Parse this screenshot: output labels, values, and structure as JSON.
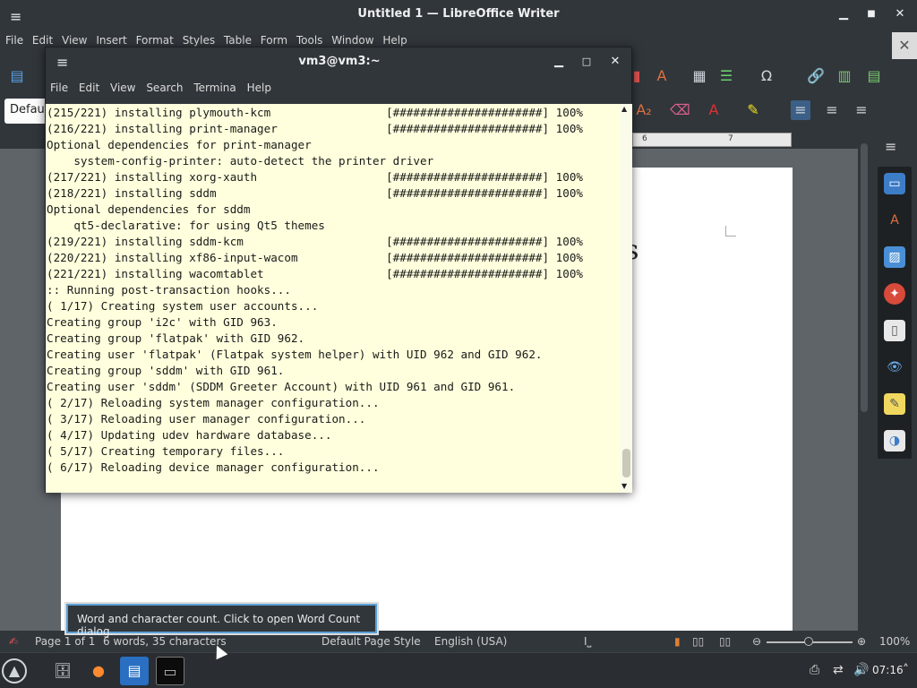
{
  "writer": {
    "title": "Untitled 1 — LibreOffice Writer",
    "menu": [
      "File",
      "Edit",
      "View",
      "Insert",
      "Format",
      "Styles",
      "Table",
      "Form",
      "Tools",
      "Window",
      "Help"
    ],
    "paragraph_style": "Default",
    "ruler_marks": [
      "6",
      "7"
    ],
    "page_visible_text": "s",
    "status": {
      "page": "Page 1 of 1",
      "words": "6 words, 35 characters",
      "page_style": "Default Page Style",
      "language": "English (USA)",
      "zoom": "100%"
    },
    "tooltip": "Word and character count. Click to open Word Count dialog."
  },
  "terminal": {
    "title": "vm3@vm3:~",
    "menu": [
      "File",
      "Edit",
      "View",
      "Search",
      "Termina",
      "Help"
    ],
    "lines": [
      "(215/221) installing plymouth-kcm                 [######################] 100%",
      "(216/221) installing print-manager                [######################] 100%",
      "Optional dependencies for print-manager",
      "    system-config-printer: auto-detect the printer driver",
      "(217/221) installing xorg-xauth                   [######################] 100%",
      "(218/221) installing sddm                         [######################] 100%",
      "Optional dependencies for sddm",
      "    qt5-declarative: for using Qt5 themes",
      "(219/221) installing sddm-kcm                     [######################] 100%",
      "(220/221) installing xf86-input-wacom             [######################] 100%",
      "(221/221) installing wacomtablet                  [######################] 100%",
      ":: Running post-transaction hooks...",
      "( 1/17) Creating system user accounts...",
      "Creating group 'i2c' with GID 963.",
      "Creating group 'flatpak' with GID 962.",
      "Creating user 'flatpak' (Flatpak system helper) with UID 962 and GID 962.",
      "Creating group 'sddm' with GID 961.",
      "Creating user 'sddm' (SDDM Greeter Account) with UID 961 and GID 961.",
      "( 2/17) Reloading system manager configuration...",
      "( 3/17) Reloading user manager configuration...",
      "( 4/17) Updating udev hardware database...",
      "( 5/17) Creating temporary files...",
      "( 6/17) Reloading device manager configuration..."
    ]
  },
  "taskbar": {
    "clock": "07:16",
    "items": [
      "app-launcher-icon",
      "file-manager-icon",
      "firefox-icon",
      "writer-icon",
      "terminal-icon"
    ],
    "tray": [
      "printer-icon",
      "network-icon",
      "volume-icon",
      "chevron-up-icon"
    ]
  }
}
